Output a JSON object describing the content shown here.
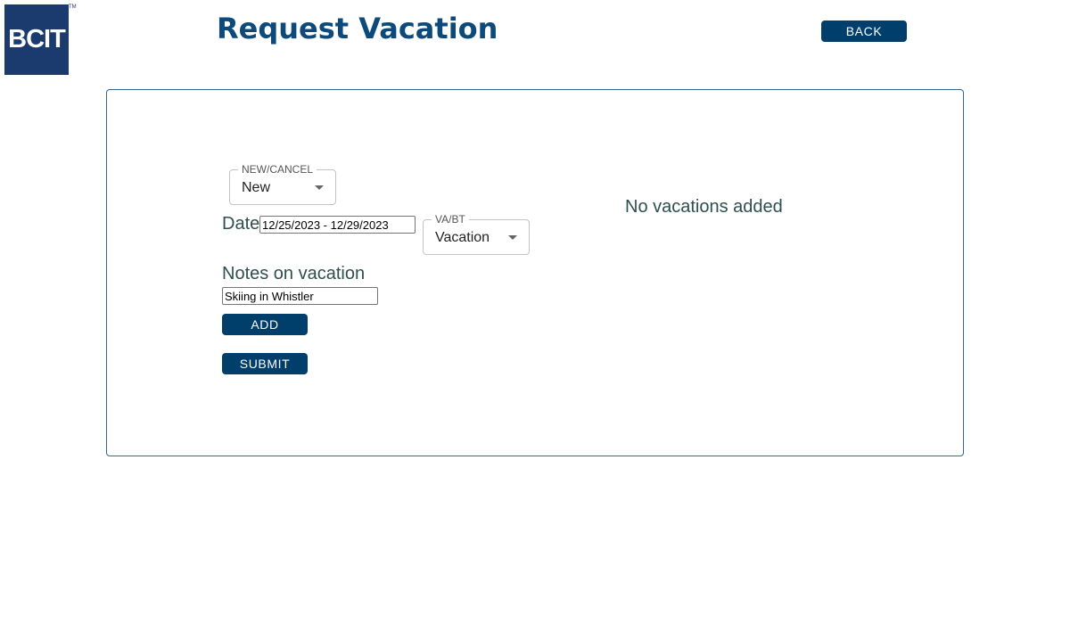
{
  "logo": {
    "text": "BCIT",
    "trademark": "TM"
  },
  "header": {
    "title": "Request Vacation",
    "back_label": "BACK"
  },
  "form": {
    "new_cancel": {
      "label": "NEW/CANCEL",
      "value": "New"
    },
    "date": {
      "label": "Date",
      "value": "12/25/2023 - 12/29/2023"
    },
    "va_bt": {
      "label": "VA/BT",
      "value": "Vacation"
    },
    "notes": {
      "label": "Notes on vacation",
      "value": "Skiing in Whistler"
    },
    "add_label": "ADD",
    "submit_label": "SUBMIT"
  },
  "vacations": {
    "empty_message": "No vacations added"
  },
  "colors": {
    "primary": "#003e6b",
    "title": "#0b4a7a",
    "panel_border": "#2f6a96",
    "logo_bg": "#1b3b6f"
  }
}
